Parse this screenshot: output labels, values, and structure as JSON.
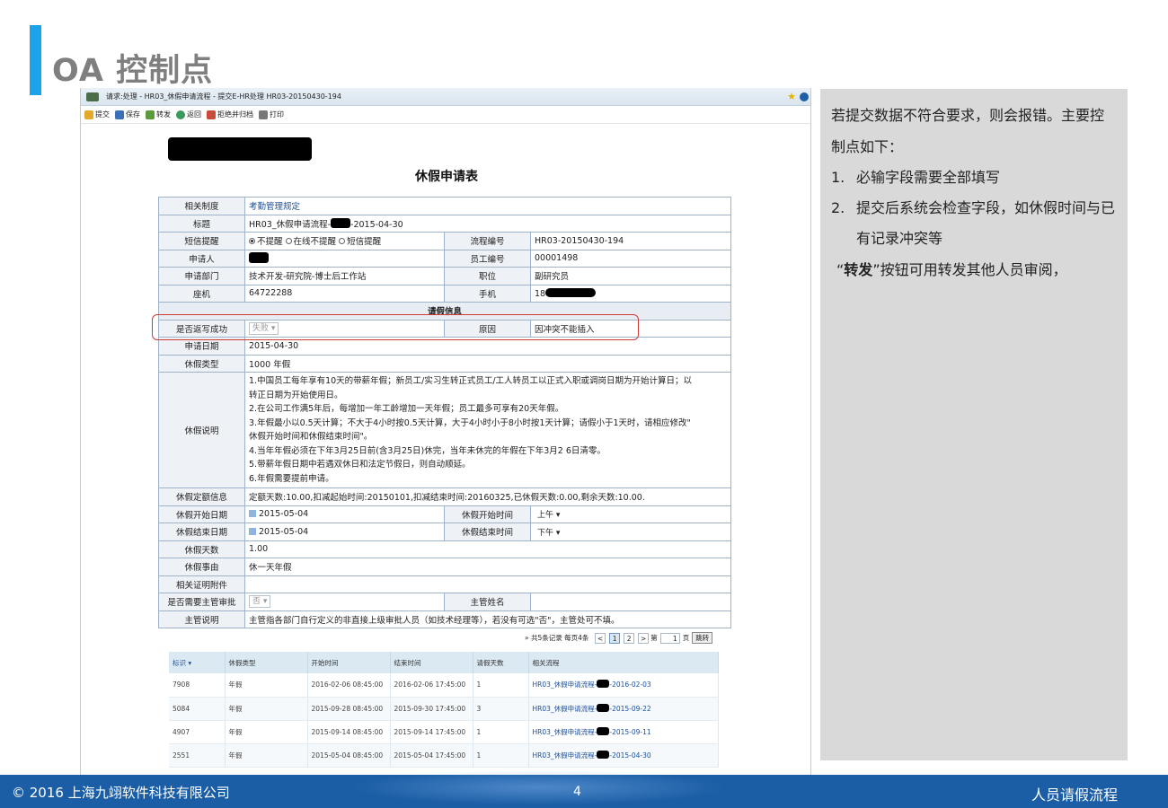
{
  "slide": {
    "title": "OA 控制点"
  },
  "window": {
    "title": "请求:处理 - HR03_休假申请流程 - 提交E-HR处理 HR03-20150430-194",
    "toolbar": [
      "提交",
      "保存",
      "转发",
      "返回",
      "拒绝并归档",
      "打印"
    ]
  },
  "form": {
    "title": "休假申请表",
    "rows": {
      "related_policy_label": "相关制度",
      "related_policy_value": "考勤管理规定",
      "subject_label": "标题",
      "subject_prefix": "HR03_休假申请流程-",
      "subject_suffix": "-2015-04-30",
      "sms_label": "短信提醒",
      "sms_opt1": "不提醒",
      "sms_opt2": "在线不提醒",
      "sms_opt3": "短信提醒",
      "flow_no_label": "流程编号",
      "flow_no_value": "HR03-20150430-194",
      "applicant_label": "申请人",
      "emp_no_label": "员工编号",
      "emp_no_value": "00001498",
      "dept_label": "申请部门",
      "dept_value": "技术开发-研究院-博士后工作站",
      "position_label": "职位",
      "position_value": "副研究员",
      "phone_label": "座机",
      "phone_value": "64722288",
      "mobile_label": "手机",
      "mobile_prefix": "18",
      "section_leave": "请假信息",
      "writeback_label": "是否返写成功",
      "writeback_value": "失败",
      "reason_label": "原因",
      "reason_value": "因冲突不能插入",
      "apply_date_label": "申请日期",
      "apply_date_value": "2015-04-30",
      "leave_type_label": "休假类型",
      "leave_type_value": "1000 年假",
      "desc_label": "休假说明",
      "desc_lines": [
        "1.中国员工每年享有10天的带薪年假；新员工/实习生转正式员工/工人转员工以正式入职或调岗日期为开始计算日；以",
        "转正日期为开始使用日。",
        "2.在公司工作满5年后，每增加一年工龄增加一天年假；员工最多可享有20天年假。",
        "3.年假最小以0.5天计算；不大于4小时按0.5天计算，大于4小时小于8小时按1天计算；请假小于1天时，请相应修改\"",
        "休假开始时间和休假结束时间\"。",
        "4.当年年假必须在下年3月25日前(含3月25日)休完，当年未休完的年假在下年3月2 6日清零。",
        "5.带薪年假日期中若遇双休日和法定节假日，则自动顺延。",
        "6.年假需要提前申请。"
      ],
      "quota_label": "休假定额信息",
      "quota_value": "定额天数:10.00,扣减起始时间:20150101,扣减结束时间:20160325,已休假天数:0.00,剩余天数:10.00.",
      "start_date_label": "休假开始日期",
      "start_date_value": "2015-05-04",
      "start_time_label": "休假开始时间",
      "start_time_value": "上午",
      "end_date_label": "休假结束日期",
      "end_date_value": "2015-05-04",
      "end_time_label": "休假结束时间",
      "end_time_value": "下午",
      "days_label": "休假天数",
      "days_value": "1.00",
      "reason2_label": "休假事由",
      "reason2_value": "休一天年假",
      "attach_label": "相关证明附件",
      "need_mgr_label": "是否需要主管审批",
      "need_mgr_value": "否",
      "mgr_name_label": "主管姓名",
      "mgr_desc_label": "主管说明",
      "mgr_desc_value": "主管指各部门自行定义的非直接上级审批人员（如技术经理等），若没有可选\"否\"，主管处可不填。"
    }
  },
  "pager": {
    "summary": "» 共5条记录  每页4条",
    "pages": [
      "<",
      "1",
      "2",
      ">"
    ],
    "page_label": "第",
    "page_value": "1",
    "page_suffix": "页",
    "go": "跳转"
  },
  "grid": {
    "headers": [
      "标识 ▾",
      "休假类型",
      "开始时间",
      "结束时间",
      "请假天数",
      "相关流程"
    ],
    "rows": [
      {
        "id": "7908",
        "type": "年假",
        "start": "2016-02-06 08:45:00",
        "end": "2016-02-06 17:45:00",
        "days": "1",
        "flow_prefix": "HR03_休假申请流程-",
        "flow_suffix": "-2016-02-03"
      },
      {
        "id": "5084",
        "type": "年假",
        "start": "2015-09-28 08:45:00",
        "end": "2015-09-30 17:45:00",
        "days": "3",
        "flow_prefix": "HR03_休假申请流程-",
        "flow_suffix": "-2015-09-22"
      },
      {
        "id": "4907",
        "type": "年假",
        "start": "2015-09-14 08:45:00",
        "end": "2015-09-14 17:45:00",
        "days": "1",
        "flow_prefix": "HR03_休假申请流程-",
        "flow_suffix": "-2015-09-11"
      },
      {
        "id": "2551",
        "type": "年假",
        "start": "2015-05-04 08:45:00",
        "end": "2015-05-04 17:45:00",
        "days": "1",
        "flow_prefix": "HR03_休假申请流程-",
        "flow_suffix": "-2015-04-30"
      }
    ]
  },
  "panel": {
    "intro": "若提交数据不符合要求，则会报错。主要控制点如下：",
    "items": [
      {
        "num": "1.",
        "text": "必输字段需要全部填写"
      },
      {
        "num": "2.",
        "text": "提交后系统会检查字段，如休假时间与已有记录冲突等"
      }
    ],
    "forward_open": "“",
    "forward_bold": "转发",
    "forward_rest": "”按钮可用转发其他人员审阅，"
  },
  "footer": {
    "copyright": "© 2016 上海九翊软件科技有限公司",
    "page": "4",
    "topic": "人员请假流程"
  },
  "colors": {
    "accent": "#1aa3e8",
    "footer": "#1b5ea5",
    "highlight": "#d23a3a"
  }
}
